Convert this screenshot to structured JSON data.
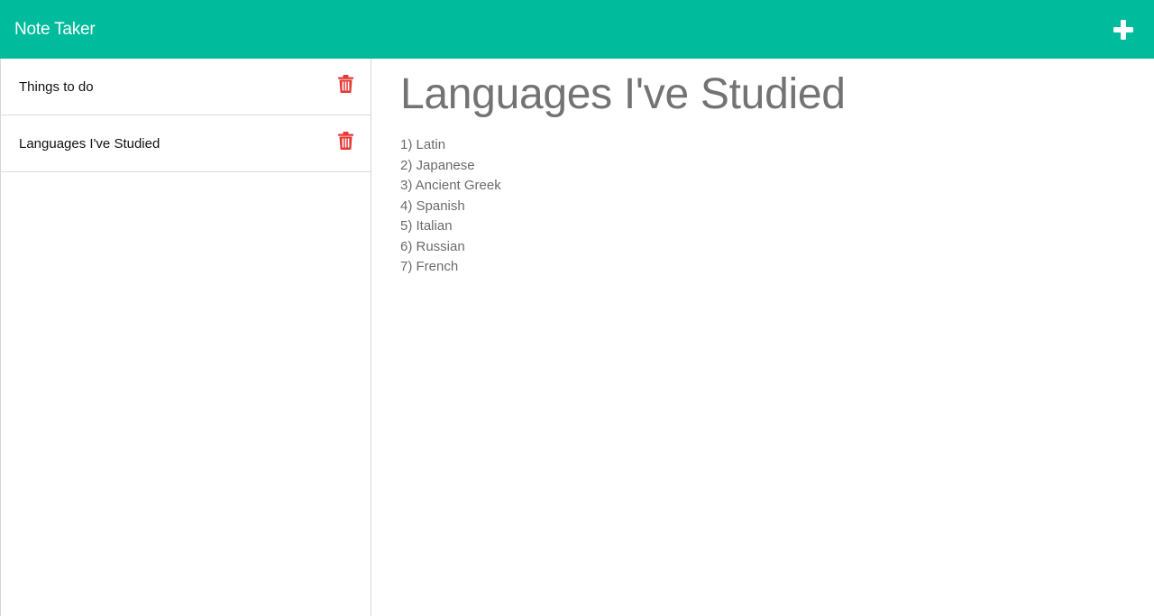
{
  "app": {
    "title": "Note Taker"
  },
  "colors": {
    "navbar": "#00bc9c",
    "trash": "#e53935"
  },
  "icons": {
    "new_note": "plus-icon",
    "delete": "trash-icon"
  },
  "notes": [
    {
      "title": "Things to do"
    },
    {
      "title": "Languages I've Studied"
    }
  ],
  "active_note": {
    "title": "Languages I've Studied",
    "lines": [
      "1) Latin",
      "2) Japanese",
      "3) Ancient Greek",
      "4) Spanish",
      "5) Italian",
      "6) Russian",
      "7) French"
    ]
  }
}
